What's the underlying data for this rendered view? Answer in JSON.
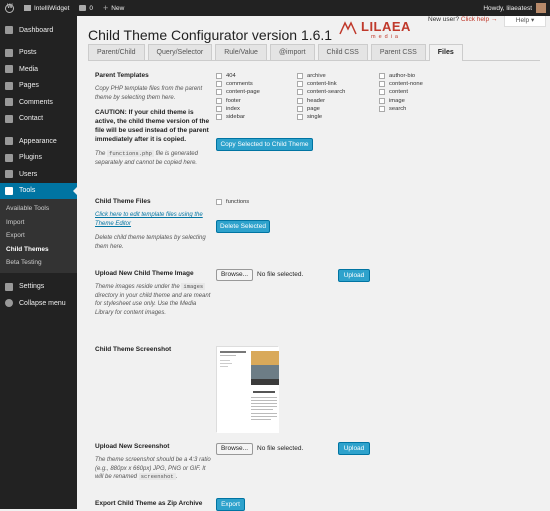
{
  "adminbar": {
    "site": "IntelliWidget",
    "comments": "0",
    "new": "New",
    "howdy": "Howdy, lilaeatest"
  },
  "sidebar": {
    "dashboard": "Dashboard",
    "posts": "Posts",
    "media": "Media",
    "pages": "Pages",
    "comments": "Comments",
    "contact": "Contact",
    "appearance": "Appearance",
    "plugins": "Plugins",
    "users": "Users",
    "tools": "Tools",
    "sub": [
      "Available Tools",
      "Import",
      "Export",
      "Child Themes",
      "Beta Testing"
    ],
    "settings": "Settings",
    "collapse": "Collapse menu"
  },
  "header": {
    "title": "Child Theme Configurator version 1.6.1",
    "logo_word": "LILAEA",
    "logo_sub": "media",
    "newuser": "New user?",
    "clickhelp": "Click help",
    "help": "Help"
  },
  "tabs": [
    "Parent/Child",
    "Query/Selector",
    "Rule/Value",
    "@import",
    "Child CSS",
    "Parent CSS",
    "Files"
  ],
  "parent_templates": {
    "label": "Parent Templates",
    "desc": "Copy PHP template files from the parent theme by selecting them here.",
    "caution": "CAUTION: If your child theme is active, the child theme version of the file will be used instead of the parent immediately after it is copied.",
    "note_pre": "The",
    "note_code": "functions.php",
    "note_post": "file is generated separately and cannot be copied here.",
    "col1": [
      "404",
      "comments",
      "content-page",
      "footer",
      "index",
      "sidebar"
    ],
    "col2": [
      "archive",
      "content-link",
      "content-search",
      "header",
      "page",
      "single"
    ],
    "col3": [
      "author-bio",
      "content-none",
      "content",
      "image",
      "search"
    ],
    "button": "Copy Selected to Child Theme"
  },
  "child_files": {
    "label": "Child Theme Files",
    "link": "Click here to edit template files using the Theme Editor",
    "desc": "Delete child theme templates by selecting them here.",
    "item": "functions",
    "button": "Delete Selected"
  },
  "upload_image": {
    "label": "Upload New Child Theme Image",
    "desc_pre": "Theme images reside under the",
    "desc_code": "images",
    "desc_post": "directory in your child theme and are meant for stylesheet use only. Use the Media Library for content images.",
    "browse": "Browse...",
    "nofile": "No file selected.",
    "button": "Upload"
  },
  "screenshot": {
    "label": "Child Theme Screenshot"
  },
  "upload_shot": {
    "label": "Upload New Screenshot",
    "desc_pre": "The theme screenshot should be a 4:3 ratio (e.g., 880px x 660px) JPG, PNG or GIF. It will be renamed",
    "desc_code": "screenshot",
    "desc_post": ".",
    "browse": "Browse...",
    "nofile": "No file selected.",
    "button": "Upload"
  },
  "export": {
    "label": "Export Child Theme as Zip Archive",
    "button": "Export"
  }
}
